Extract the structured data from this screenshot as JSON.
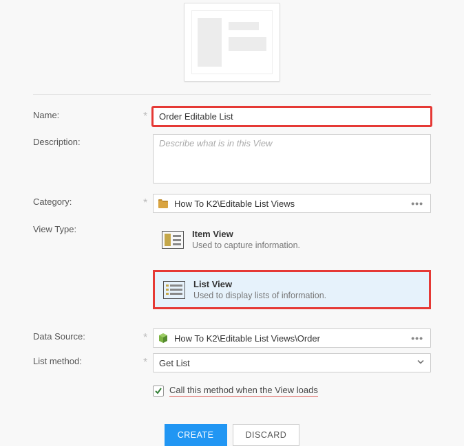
{
  "labels": {
    "name": "Name:",
    "description": "Description:",
    "category": "Category:",
    "view_type": "View Type:",
    "data_source": "Data Source:",
    "list_method": "List method:"
  },
  "fields": {
    "name_value": "Order Editable List",
    "description_placeholder": "Describe what is in this View",
    "category_value": "How To K2\\Editable List Views",
    "data_source_value": "How To K2\\Editable List Views\\Order",
    "list_method_value": "Get List"
  },
  "view_types": {
    "item": {
      "title": "Item View",
      "sub": "Used to capture information."
    },
    "list": {
      "title": "List View",
      "sub": "Used to display lists of information."
    }
  },
  "checkbox": {
    "label": "Call this method when the View loads"
  },
  "buttons": {
    "create": "CREATE",
    "discard": "DISCARD"
  },
  "required_mark": "*"
}
